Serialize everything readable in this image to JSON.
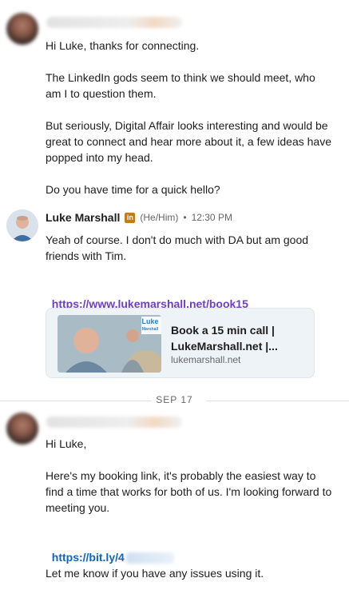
{
  "thread": {
    "message1": {
      "body": "Hi Luke, thanks for connecting.\n\nThe LinkedIn gods seem to think we should meet, who am I to question them.\n\nBut seriously, Digital Affair looks interesting and would be great to connect and hear more about it, a few ideas have popped into my head.\n\nDo you have time for a quick hello?"
    },
    "message2": {
      "sender_name": "Luke Marshall",
      "badge": "in",
      "pronouns": "(He/Him)",
      "separator": "•",
      "time": "12:30 PM",
      "body": "Yeah of course. I don't do much with DA but am good friends with Tim.",
      "link": "https://www.lukemarshall.net/book15",
      "preview": {
        "thumb_logo_line1": "Luke",
        "thumb_logo_line2": "Marshall",
        "title": "Book a 15 min call |\nLukeMarshall.net |...",
        "domain": "lukemarshall.net"
      }
    },
    "date_divider": "SEP 17",
    "message3": {
      "body_intro": "Hi Luke,\n\nHere's my booking link, it's probably the easiest way to find a time that works for both of us. I'm looking forward to meeting you.",
      "link_visible": "https://bit.ly/4",
      "body_outro": "Let me know if you have any issues using it."
    }
  }
}
